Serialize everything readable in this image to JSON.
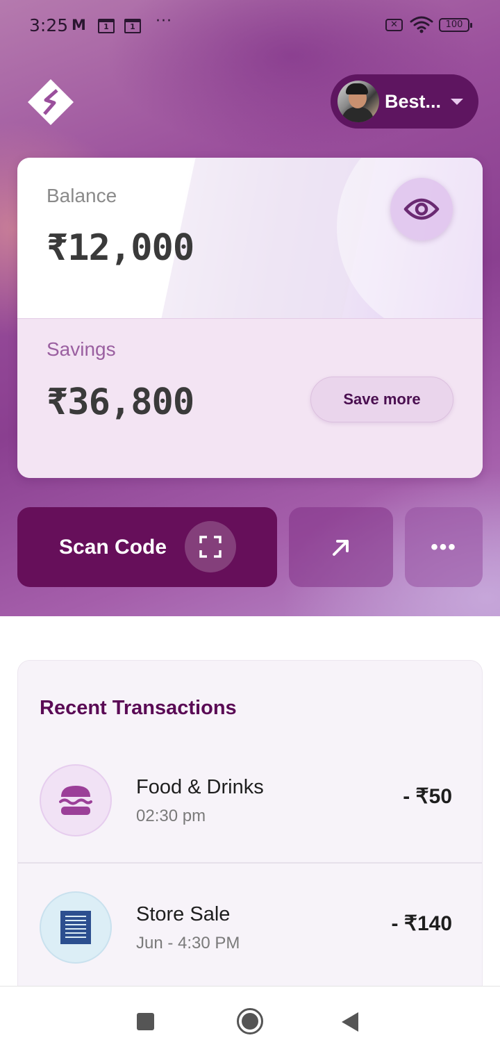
{
  "status_bar": {
    "time": "3:25",
    "gmail_icon": "M",
    "calendar_day_1": "1",
    "calendar_day_2": "1",
    "more_notifications": "···",
    "sim_icon": "✕",
    "battery": "100"
  },
  "header": {
    "logo_icon": "app-logo-diamond",
    "profile_name": "Best...",
    "dropdown_icon": "chevron-down-icon"
  },
  "balance_card": {
    "balance_label": "Balance",
    "balance_amount": "₹12,000",
    "toggle_visibility_icon": "eye-icon",
    "savings_label": "Savings",
    "savings_amount": "₹36,800",
    "save_more_label": "Save more"
  },
  "actions": {
    "scan_label": "Scan Code",
    "scan_icon": "scan-frame-icon",
    "send_icon": "arrow-up-right-icon",
    "more_icon": "more-horizontal-icon",
    "more_glyph": "•••"
  },
  "transactions": {
    "title": "Recent Transactions",
    "items": [
      {
        "name": "Food & Drinks",
        "time": "02:30 pm",
        "amount": "- ₹50",
        "icon": "burger-icon",
        "accent": "#9b3f98"
      },
      {
        "name": "Store Sale",
        "time": "Jun - 4:30 PM",
        "amount": "- ₹140",
        "icon": "document-icon",
        "accent": "#2c4f8f"
      }
    ]
  },
  "colors": {
    "primary": "#660f5a",
    "title_purple": "#5a0a55",
    "card_savings_bg": "#f3e4f3"
  }
}
